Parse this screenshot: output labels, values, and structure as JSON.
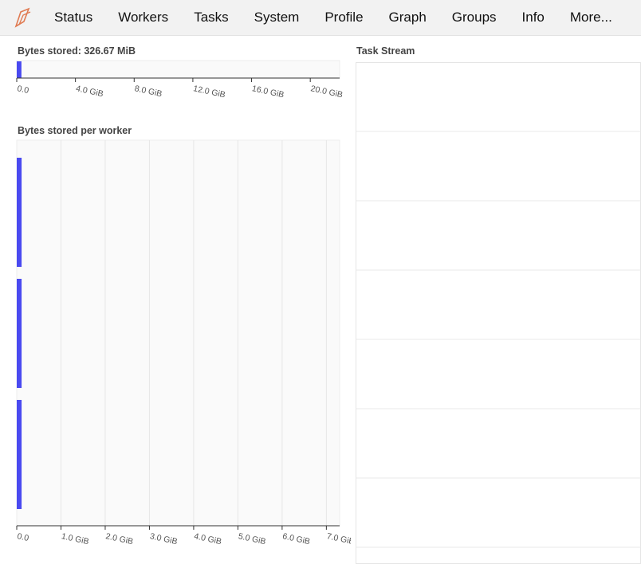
{
  "nav": {
    "items": [
      "Status",
      "Workers",
      "Tasks",
      "System",
      "Profile",
      "Graph",
      "Groups",
      "Info",
      "More..."
    ]
  },
  "colors": {
    "bar": "#4a4af0",
    "logo": "#e07b52",
    "plot_bg": "#fafafa",
    "grid": "#e6e6e6"
  },
  "panels": {
    "bytes_stored": {
      "title": "Bytes stored: 326.67 MiB"
    },
    "per_worker": {
      "title": "Bytes stored per worker"
    },
    "task_stream": {
      "title": "Task Stream"
    }
  },
  "chart_data": [
    {
      "type": "bar",
      "orientation": "horizontal",
      "title": "Bytes stored: 326.67 MiB",
      "unit": "GiB",
      "values": [
        0.32
      ],
      "xlim": [
        0,
        22
      ],
      "xticks": [
        0,
        4,
        8,
        12,
        16,
        20
      ],
      "xtick_labels": [
        "0.0",
        "4.0 GiB",
        "8.0 GiB",
        "12.0 GiB",
        "16.0 GiB",
        "20.0 GiB"
      ],
      "grid": false
    },
    {
      "type": "bar",
      "orientation": "horizontal",
      "title": "Bytes stored per worker",
      "unit": "GiB",
      "values": [
        0.11,
        0.11,
        0.11
      ],
      "xlim": [
        0,
        7.3
      ],
      "xticks": [
        0,
        1,
        2,
        3,
        4,
        5,
        6,
        7
      ],
      "xtick_labels": [
        "0.0",
        "1.0 GiB",
        "2.0 GiB",
        "3.0 GiB",
        "4.0 GiB",
        "5.0 GiB",
        "6.0 GiB",
        "7.0 GiB"
      ],
      "grid": true
    }
  ]
}
